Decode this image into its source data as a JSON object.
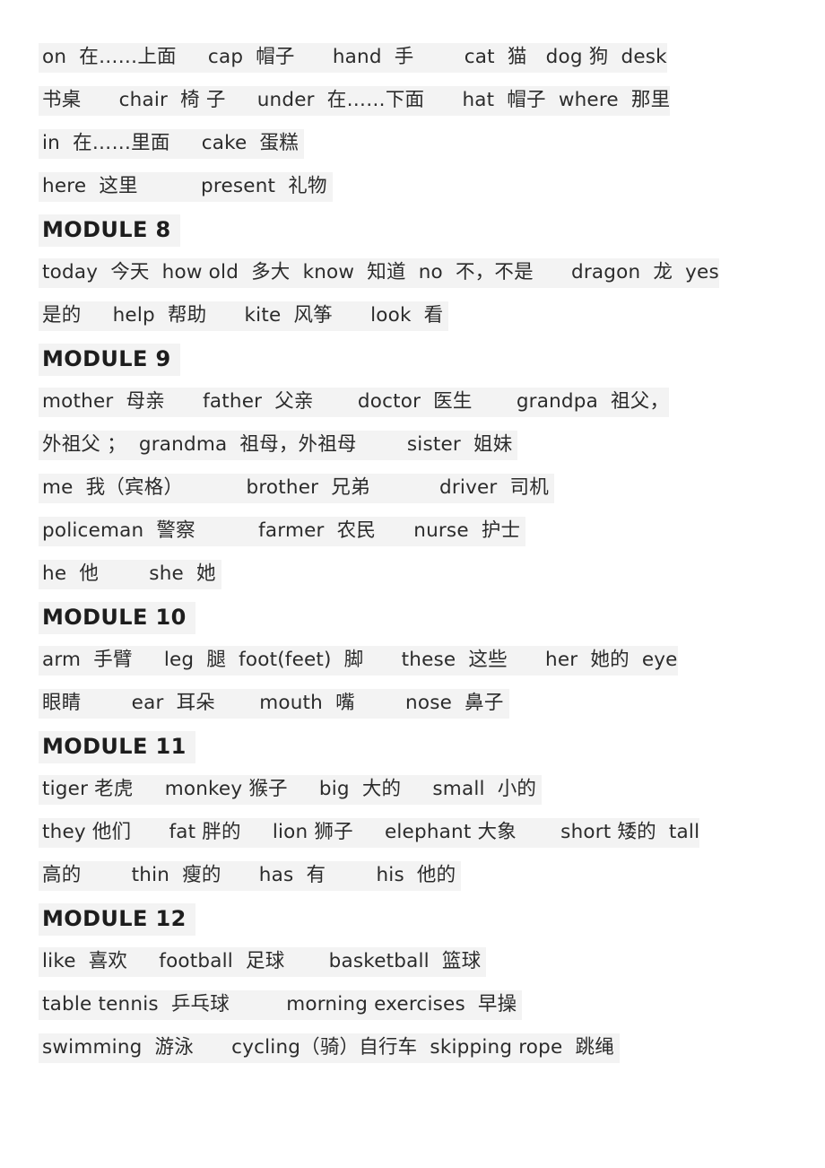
{
  "document": {
    "type": "vocabulary-list",
    "language_pair": "English-Chinese",
    "page_background": "#ffffff",
    "highlight_color": "#f3f3f3",
    "text_color": "#2b2b2b"
  },
  "blocks": [
    {
      "kind": "vocab",
      "id": "line-1",
      "text": "on  在……上面     cap  帽子      hand  手        cat  猫   dog 狗  desk"
    },
    {
      "kind": "vocab",
      "id": "line-2",
      "text": "书桌      chair  椅 子     under  在……下面      hat  帽子  where  那里"
    },
    {
      "kind": "vocab",
      "id": "line-3",
      "text": "in  在……里面     cake  蛋糕"
    },
    {
      "kind": "vocab",
      "id": "line-4",
      "text": "here  这里          present  礼物"
    },
    {
      "kind": "heading",
      "id": "module-8-heading",
      "text": "MODULE 8"
    },
    {
      "kind": "vocab",
      "id": "line-5",
      "text": "today  今天  how old  多大  know  知道  no  不，不是      dragon  龙  yes"
    },
    {
      "kind": "vocab",
      "id": "line-6",
      "text": "是的     help  帮助      kite  风筝      look  看"
    },
    {
      "kind": "heading",
      "id": "module-9-heading",
      "text": "MODULE 9"
    },
    {
      "kind": "vocab",
      "id": "line-7",
      "text": "mother  母亲      father  父亲       doctor  医生       grandpa  祖父，"
    },
    {
      "kind": "vocab",
      "id": "line-8",
      "text": "外祖父 ；  grandma  祖母，外祖母        sister  姐妹"
    },
    {
      "kind": "vocab",
      "id": "line-9",
      "text": "me  我（宾格）          brother  兄弟           driver  司机"
    },
    {
      "kind": "vocab",
      "id": "line-10",
      "text": "policeman  警察          farmer  农民      nurse  护士"
    },
    {
      "kind": "vocab",
      "id": "line-11",
      "text": "he  他        she  她"
    },
    {
      "kind": "heading",
      "id": "module-10-heading",
      "text": "MODULE 10"
    },
    {
      "kind": "vocab",
      "id": "line-12",
      "text": "arm  手臂     leg  腿  foot(feet)  脚      these  这些      her  她的  eye"
    },
    {
      "kind": "vocab",
      "id": "line-13",
      "text": "眼睛        ear  耳朵       mouth  嘴        nose  鼻子"
    },
    {
      "kind": "heading",
      "id": "module-11-heading",
      "text": "MODULE 11"
    },
    {
      "kind": "vocab",
      "id": "line-14",
      "text": "tiger 老虎     monkey 猴子     big  大的     small  小的"
    },
    {
      "kind": "vocab",
      "id": "line-15",
      "text": "they 他们      fat 胖的     lion 狮子     elephant 大象       short 矮的  tall"
    },
    {
      "kind": "vocab",
      "id": "line-16",
      "text": "高的        thin  瘦的      has  有        his  他的"
    },
    {
      "kind": "heading",
      "id": "module-12-heading",
      "text": "MODULE 12"
    },
    {
      "kind": "vocab",
      "id": "line-17",
      "text": "like  喜欢     football  足球       basketball  篮球"
    },
    {
      "kind": "vocab",
      "id": "line-18",
      "text": "table tennis  乒乓球         morning exercises  早操"
    },
    {
      "kind": "vocab",
      "id": "line-19",
      "text": "swimming  游泳      cycling（骑）自行车  skipping rope  跳绳"
    }
  ]
}
